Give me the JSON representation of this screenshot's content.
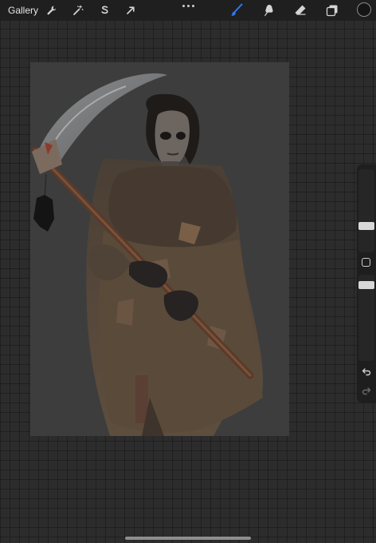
{
  "toolbar": {
    "gallery_label": "Gallery",
    "left_tools": [
      {
        "icon": "wrench-icon",
        "name": "actions"
      },
      {
        "icon": "magic-wand-icon",
        "name": "adjustments"
      },
      {
        "icon": "selection-s-icon",
        "name": "selection"
      },
      {
        "icon": "arrow-cursor-icon",
        "name": "transform"
      }
    ],
    "more_icon": "ellipsis-icon",
    "right_tools": [
      {
        "icon": "brush-icon",
        "name": "brush",
        "active": true
      },
      {
        "icon": "smudge-icon",
        "name": "smudge"
      },
      {
        "icon": "eraser-icon",
        "name": "eraser"
      },
      {
        "icon": "layers-icon",
        "name": "layers"
      }
    ],
    "current_color": "#151515"
  },
  "sidebar": {
    "brush_size_level": 0.28,
    "brush_opacity_level": 0.5,
    "modify_icon": "square-modify-icon",
    "undo_icon": "undo-arrow-icon",
    "redo_icon": "redo-arrow-icon"
  },
  "canvas": {
    "background": "#3d3d3d",
    "artwork": "reaper-figure-illustration"
  },
  "colors": {
    "accent": "#2f7bf6",
    "toolbar_bg": "#1f1f1f",
    "workspace_bg": "#2c2c2c"
  }
}
